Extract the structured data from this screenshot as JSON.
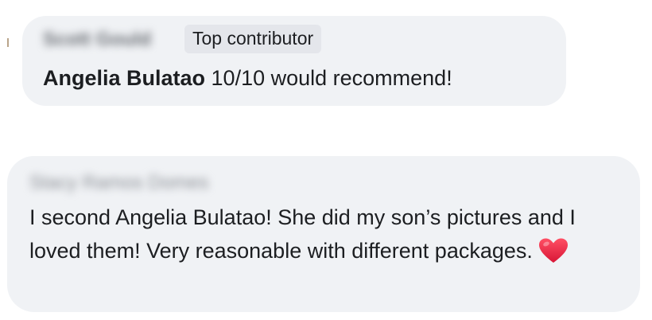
{
  "comments": [
    {
      "author": "Scott Gould",
      "badge": "Top contributor",
      "tagged_name": "Angelia Bulatao",
      "text": " 10/10 would recommend!"
    },
    {
      "author": "Stacy Ramos Domes",
      "text": "I second Angelia Bulatao! She did my son’s pictures and I loved them! Very reasonable with different packages.",
      "emoji": "heart-icon",
      "emoji_color": "#e0245e"
    }
  ],
  "colors": {
    "bubble": "#f0f2f5",
    "badge": "#e4e6eb",
    "text": "#1c1e21"
  }
}
